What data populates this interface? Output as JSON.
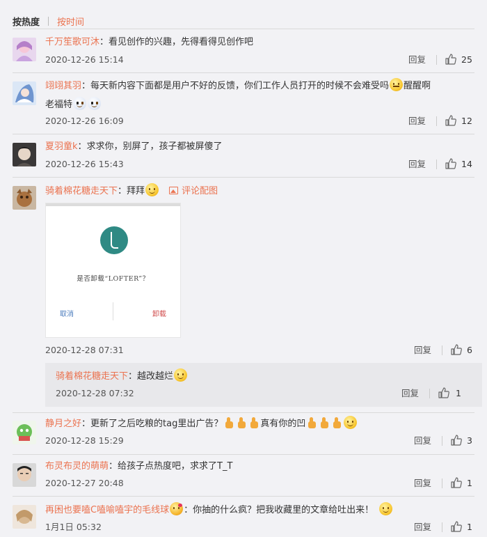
{
  "sort": {
    "hot": "按热度",
    "time": "按时间"
  },
  "labels": {
    "reply": "回复",
    "pic_comment": "评论配图"
  },
  "comments": [
    {
      "user": "千万笙歌可沐",
      "text": "：看见创作的兴趣，先得看得见创作吧",
      "time": "2020-12-26 15:14",
      "likes": "25"
    },
    {
      "user": "翊翊其羽",
      "text": "：每天新内容下面都是用户不好的反馈，你们工作人员打开的时候不会难受吗",
      "text_after": "醒醒啊",
      "text2": "老福特",
      "time": "2020-12-26 16:09",
      "likes": "12"
    },
    {
      "user": "夏羽童k",
      "text": "：求求你，别屏了，孩子都被屏傻了",
      "time": "2020-12-26 15:43",
      "likes": "14"
    },
    {
      "user": "骑着棉花糖走天下",
      "text": "：拜拜",
      "time": "2020-12-28 07:31",
      "likes": "6",
      "image": {
        "question": "是否卸载“LOFTER”？",
        "cancel": "取消",
        "uninstall": "卸载"
      },
      "reply": {
        "user": "骑着棉花糖走天下",
        "text": "：越改越烂",
        "time": "2020-12-28 07:32",
        "likes": "1"
      }
    },
    {
      "user": "静月之好",
      "text": "：更新了之后吃粮的tag里出广告？",
      "text_mid": "真有你的凹",
      "time": "2020-12-28 15:29",
      "likes": "3"
    },
    {
      "user": "布灵布灵的萌萌",
      "text": "：给孩子点热度吧，求求了T_T",
      "time": "2020-12-27 20:48",
      "likes": "1"
    },
    {
      "user": "再困也要嗑C嗑喻嗑宇的毛线球",
      "text": "：你抽的什么疯？把我收藏里的文章给吐出来！",
      "time": "1月1日 05:32",
      "likes": "1"
    }
  ],
  "icons": {
    "like": "thumbs-up-icon",
    "pic": "picture-icon"
  },
  "colors": {
    "accent": "#eb7350",
    "background": "#f2f2f5",
    "sub_reply_bg": "#e8e8eb"
  }
}
